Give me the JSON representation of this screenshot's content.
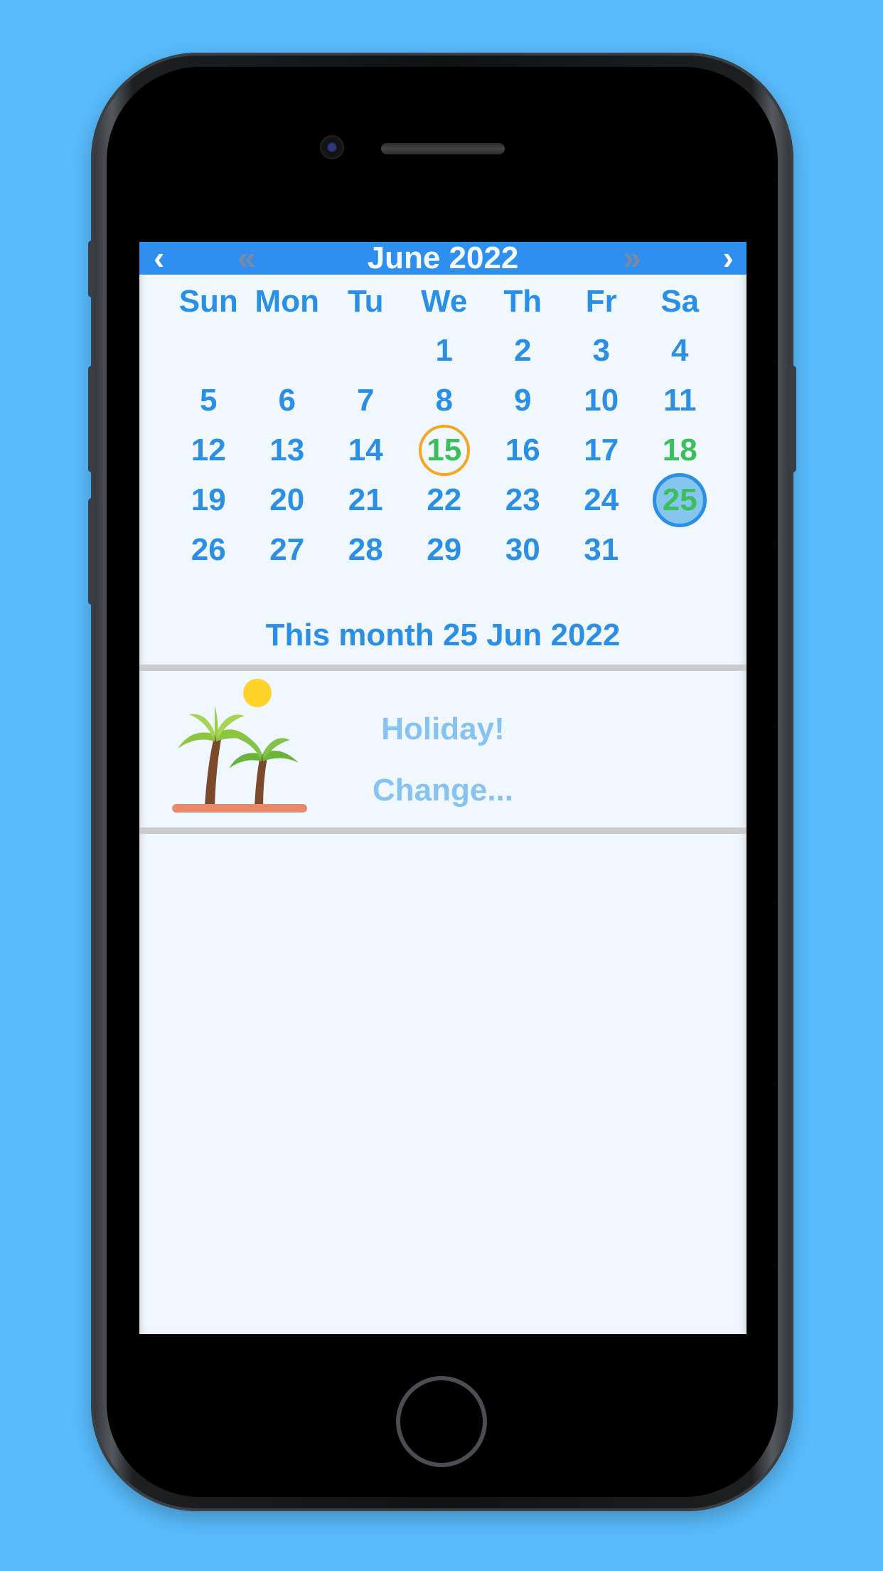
{
  "calendar": {
    "title": "June 2022",
    "nav": {
      "prev_month": "‹",
      "prev_year": "«",
      "next_year": "»",
      "next_month": "›"
    },
    "weekdays": [
      "Sun",
      "Mon",
      "Tu",
      "We",
      "Th",
      "Fr",
      "Sa"
    ],
    "weeks": [
      [
        "",
        "",
        "",
        "1",
        "2",
        "3",
        "4"
      ],
      [
        "5",
        "6",
        "7",
        "8",
        "9",
        "10",
        "11"
      ],
      [
        "12",
        "13",
        "14",
        "15",
        "16",
        "17",
        "18"
      ],
      [
        "19",
        "20",
        "21",
        "22",
        "23",
        "24",
        "25"
      ],
      [
        "26",
        "27",
        "28",
        "29",
        "30",
        "31",
        ""
      ]
    ],
    "today": "15",
    "selected": "25",
    "green_days": [
      "15",
      "18",
      "25"
    ]
  },
  "summary": {
    "text": "This month 25 Jun 2022"
  },
  "event": {
    "title": "Holiday!",
    "change_label": "Change...",
    "icon": "palm-trees-icon"
  },
  "colors": {
    "header": "#2e8ff0",
    "day_text": "#2b8fe6",
    "holiday_day": "#3bbf5a",
    "today_ring": "#f5a623",
    "background": "#59bcfd"
  }
}
